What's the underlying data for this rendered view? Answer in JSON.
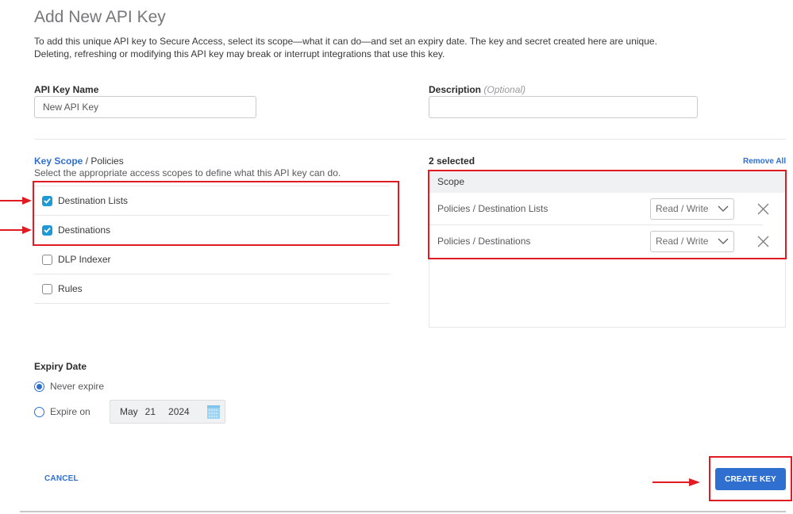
{
  "page": {
    "title": "Add New API Key",
    "intro_line1": "To add this unique API key to Secure Access, select its scope—what it can do—and set an expiry date. The key and secret created here are unique.",
    "intro_line2": "Deleting, refreshing or modifying this API key may break or interrupt integrations that use this key."
  },
  "form": {
    "name_label": "API Key Name",
    "name_value": "New API Key",
    "description_label": "Description",
    "description_optional": "(Optional)",
    "description_value": ""
  },
  "key_scope": {
    "title_link": "Key Scope",
    "title_rest": "/ Policies",
    "description": "Select the appropriate access scopes to define what this API key can do.",
    "items": [
      {
        "label": "Destination Lists",
        "checked": true
      },
      {
        "label": "Destinations",
        "checked": true
      },
      {
        "label": "DLP Indexer",
        "checked": false
      },
      {
        "label": "Rules",
        "checked": false
      }
    ]
  },
  "selected": {
    "count_label": "2 selected",
    "remove_all": "Remove All",
    "header": "Scope",
    "rows": [
      {
        "scope": "Policies / Destination Lists",
        "access": "Read / Write"
      },
      {
        "scope": "Policies / Destinations",
        "access": "Read / Write"
      }
    ]
  },
  "expiry": {
    "label": "Expiry Date",
    "options": [
      {
        "label": "Never expire",
        "selected": true
      },
      {
        "label": "Expire on",
        "selected": false
      }
    ],
    "date": {
      "month": "May",
      "day": "21",
      "year": "2024"
    }
  },
  "actions": {
    "cancel": "CANCEL",
    "create": "CREATE KEY"
  },
  "colors": {
    "accent": "#2f6fd0",
    "checkbox": "#1d9ad6",
    "annotation": "#e11b22"
  }
}
